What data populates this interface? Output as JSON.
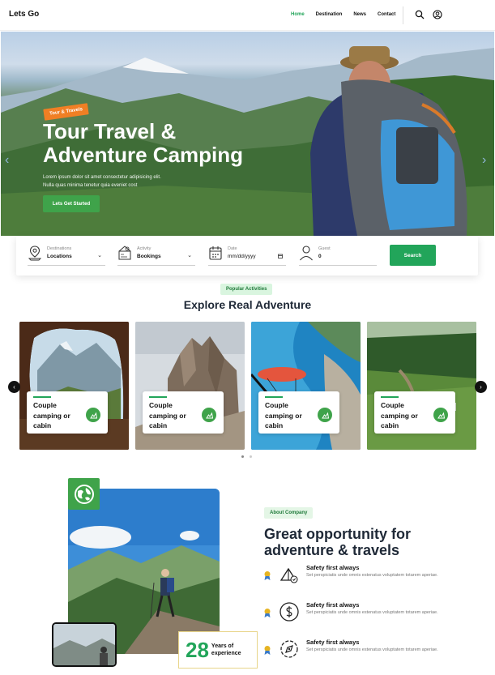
{
  "nav": {
    "brand": "Lets Go",
    "links": [
      "Home",
      "Destination",
      "News",
      "Contact"
    ],
    "active": "Home",
    "icons": [
      "search-icon",
      "user-icon"
    ]
  },
  "hero": {
    "badge": "Tour & Travels",
    "title_line1": "Tour Travel &",
    "title_line2": "Adventure Camping",
    "subtitle_line1": "Lorem ipsum dolor sit amet consectetur adipisicing elit.",
    "subtitle_line2": "Nulla quas minima tenetur quia eveniet cost",
    "cta": "Lets Get Started",
    "prev": "‹",
    "next": "›"
  },
  "search": {
    "destination": {
      "label": "Destinations",
      "value": "Locations"
    },
    "activity": {
      "label": "Activity",
      "value": "Bookings"
    },
    "date": {
      "label": "Date",
      "value": "mm/dd/yyyy"
    },
    "guest": {
      "label": "Guest",
      "value": "0"
    },
    "button": "Search"
  },
  "activities": {
    "badge": "Popular Activities",
    "title": "Explore Real Adventure",
    "card_title_line1": "Couple",
    "card_title_line2": "camping or",
    "card_title_line3": "cabin",
    "prev": "‹",
    "next": "›",
    "page_count": 2,
    "active_page": 1
  },
  "about": {
    "badge": "About Company",
    "title_line1": "Great opportunity for",
    "title_line2": "adventure & travels",
    "years": "28",
    "years_label_line1": "Years of",
    "years_label_line2": "experience",
    "features": [
      {
        "title": "Safety first always",
        "desc": "Set perspiciatis unde omnis estenatus voluptatem totarem aperiae.",
        "icon": "tent-icon"
      },
      {
        "title": "Safety first always",
        "desc": "Set perspiciatis unde omnis estenatus voluptatem totarem aperiae.",
        "icon": "dollar-icon"
      },
      {
        "title": "Safety first always",
        "desc": "Set perspiciatis unde omnis estenatus voluptatem totarem aperiae.",
        "icon": "compass-icon"
      }
    ]
  },
  "colors": {
    "primary_green": "#22a55a",
    "badge_orange": "#f07f24",
    "pill_bg": "#d9f5df"
  }
}
